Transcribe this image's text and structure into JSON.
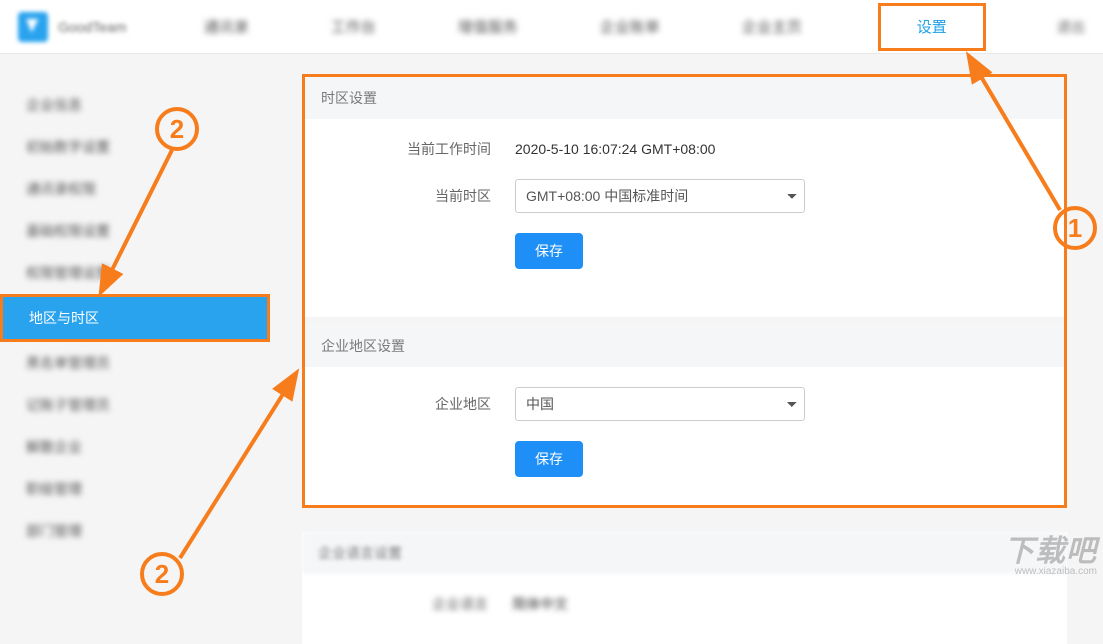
{
  "topbar": {
    "brand": "GoodTeam",
    "nav": [
      {
        "label": "通讯录"
      },
      {
        "label": "工作台"
      },
      {
        "label": "增值服务"
      },
      {
        "label": "企业账单"
      },
      {
        "label": "企业主页"
      },
      {
        "label": "设置",
        "active": true
      }
    ],
    "right": "退出"
  },
  "sidebar": {
    "items": [
      {
        "label": "企业信息"
      },
      {
        "label": "初始数字设置"
      },
      {
        "label": "通讯录权限"
      },
      {
        "label": "基础权限设置"
      },
      {
        "label": "权限管理设置"
      },
      {
        "label": "地区与时区",
        "active": true
      },
      {
        "label": "黑名单管理员"
      },
      {
        "label": "记账子管理员"
      },
      {
        "label": "解散企业"
      },
      {
        "label": "职级管理"
      },
      {
        "label": "部门管理"
      }
    ]
  },
  "timezone_panel": {
    "title": "时区设置",
    "current_work_time_label": "当前工作时间",
    "current_work_time_value": "2020-5-10 16:07:24 GMT+08:00",
    "current_tz_label": "当前时区",
    "current_tz_value": "GMT+08:00 中国标准时间",
    "save": "保存"
  },
  "region_panel": {
    "title": "企业地区设置",
    "region_label": "企业地区",
    "region_value": "中国",
    "save": "保存"
  },
  "language_panel": {
    "title": "企业语言设置",
    "lang_label": "企业语言",
    "lang_value": "简体中文"
  },
  "annotations": {
    "one": "1",
    "two": "2"
  },
  "watermark": {
    "big": "下载吧",
    "small": "www.xiazaiba.com"
  }
}
